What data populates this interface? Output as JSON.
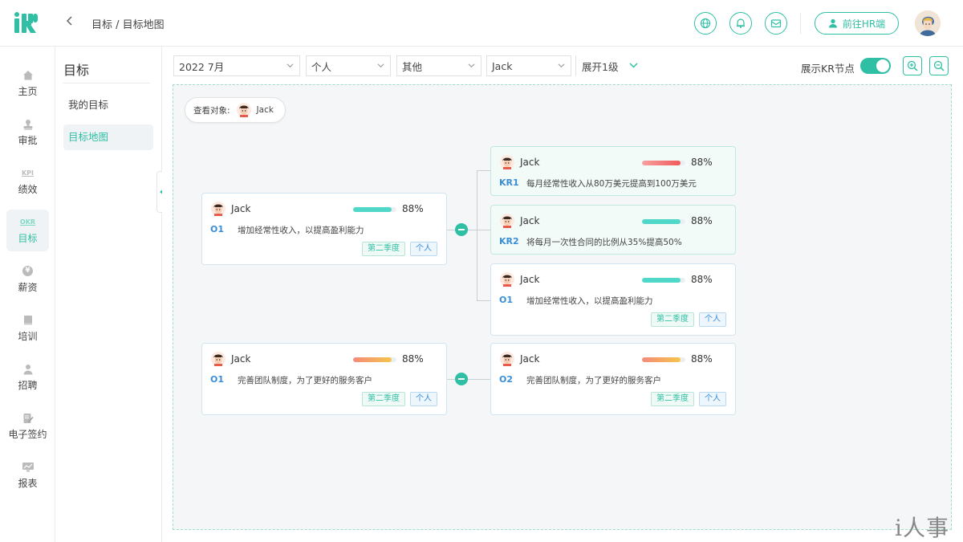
{
  "header": {
    "logo": "iHR",
    "breadcrumb": "目标 / 目标地图",
    "hr_button_label": "前往HR端",
    "icons": [
      "globe-icon",
      "bell-icon",
      "mail-icon"
    ]
  },
  "rail": [
    {
      "label": "主页",
      "icon": "home-icon"
    },
    {
      "label": "审批",
      "icon": "stamp-icon"
    },
    {
      "label": "绩效",
      "icon": "kpi-icon",
      "glyph": "KPI"
    },
    {
      "label": "目标",
      "icon": "okr-icon",
      "glyph": "OKR",
      "active": true
    },
    {
      "label": "薪资",
      "icon": "yen-icon",
      "glyph": "¥"
    },
    {
      "label": "培训",
      "icon": "book-icon"
    },
    {
      "label": "招聘",
      "icon": "user-icon"
    },
    {
      "label": "电子签约",
      "icon": "sign-icon"
    },
    {
      "label": "报表",
      "icon": "chart-icon"
    }
  ],
  "subnav": {
    "title": "目标",
    "items": [
      {
        "label": "我的目标"
      },
      {
        "label": "目标地图",
        "active": true
      }
    ]
  },
  "filters": {
    "period": "2022 7月",
    "scope": "个人",
    "type": "其他",
    "person": "Jack",
    "expand": "展开1级",
    "kr_toggle_label": "展示KR节点",
    "kr_toggle_on": true
  },
  "viewer": {
    "label": "查看对象:",
    "name": "Jack"
  },
  "cards": {
    "o1a": {
      "name": "Jack",
      "pct": "88%",
      "progress": 0.88,
      "code": "O1",
      "text": "增加经常性收入，以提高盈利能力",
      "quarter": "第二季度",
      "scope": "个人"
    },
    "kr1": {
      "name": "Jack",
      "pct": "88%",
      "progress": 0.88,
      "code": "KR1",
      "text": "每月经常性收入从80万美元提高到100万美元"
    },
    "kr2": {
      "name": "Jack",
      "pct": "88%",
      "progress": 0.88,
      "code": "KR2",
      "text": "将每月一次性合同的比例从35%提高50%"
    },
    "o1b": {
      "name": "Jack",
      "pct": "88%",
      "progress": 0.88,
      "code": "O1",
      "text": "增加经常性收入，以提高盈利能力",
      "quarter": "第二季度",
      "scope": "个人"
    },
    "o1c": {
      "name": "Jack",
      "pct": "88%",
      "progress": 0.88,
      "code": "O1",
      "text": "完善团队制度，为了更好的服务客户",
      "quarter": "第二季度",
      "scope": "个人"
    },
    "o2": {
      "name": "Jack",
      "pct": "88%",
      "progress": 0.88,
      "code": "O2",
      "text": "完善团队制度，为了更好的服务客户",
      "quarter": "第二季度",
      "scope": "个人"
    }
  },
  "colors": {
    "accent": "#2fbfa4",
    "bar_teal": "#4fd8c8",
    "bar_red": "#f05a5a",
    "bar_orange": "#f6b34c"
  },
  "watermark": "i人事"
}
